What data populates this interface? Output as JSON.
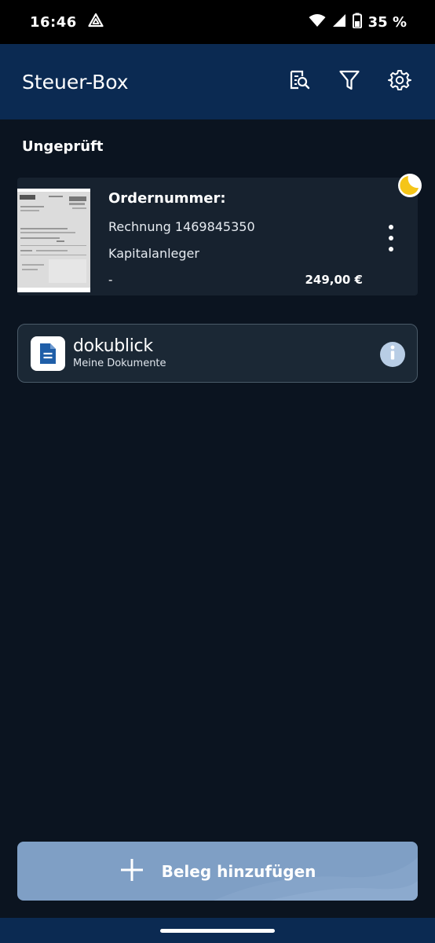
{
  "status_bar": {
    "time": "16:46",
    "battery": "35 %",
    "icons": [
      "drive-triangle-icon",
      "wifi-icon",
      "signal-icon",
      "battery-icon"
    ]
  },
  "app_bar": {
    "title": "Steuer-Box",
    "actions": [
      "search-document-icon",
      "filter-icon",
      "settings-icon"
    ]
  },
  "section": {
    "title": "Ungeprüft"
  },
  "receipt": {
    "heading": "Ordernummer:",
    "line1": "Rechnung 1469845350",
    "line2": "Kapitalanleger",
    "date": "-",
    "amount": "249,00 €",
    "status_icon": "half-moon-pending-icon"
  },
  "dokublick": {
    "brand_a": "doku",
    "brand_b": "blick",
    "subtitle": "Meine Dokumente"
  },
  "add_button": {
    "label": "Beleg hinzufügen"
  },
  "colors": {
    "background": "#0b1420",
    "app_bar": "#0b2a52",
    "card": "#17222f",
    "button": "#7f9fc5",
    "moon": "#f5c518"
  }
}
